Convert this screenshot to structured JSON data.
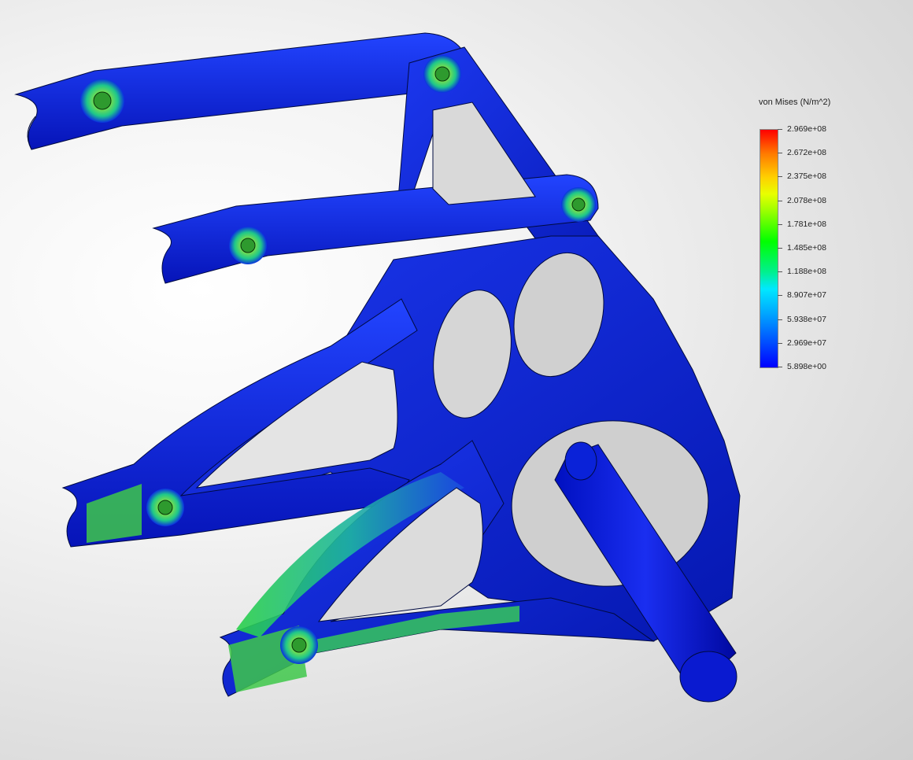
{
  "legend": {
    "title": "von Mises (N/m^2)",
    "ticks": [
      "2.969e+08",
      "2.672e+08",
      "2.375e+08",
      "2.078e+08",
      "1.781e+08",
      "1.485e+08",
      "1.188e+08",
      "8.907e+07",
      "5.938e+07",
      "2.969e+07",
      "5.898e+00"
    ],
    "colors": {
      "max": "#ff0000",
      "high": "#ffd000",
      "mid": "#00ff00",
      "low_mid": "#00e8ff",
      "min": "#0000ff"
    }
  },
  "model": {
    "base_color": "#0a2fd8",
    "stress_color": "#3fd84a",
    "pin_count": 6
  }
}
